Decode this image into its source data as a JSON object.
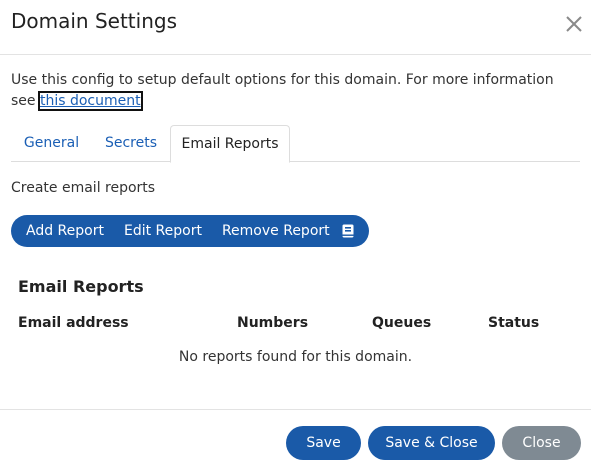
{
  "dialog": {
    "title": "Domain Settings",
    "close_icon": "close-icon"
  },
  "intro": {
    "text": "Use this config to setup default options for this domain. For more information see ",
    "link_text": "this document"
  },
  "tabs": [
    {
      "label": "General",
      "active": false
    },
    {
      "label": "Secrets",
      "active": false
    },
    {
      "label": "Email Reports",
      "active": true
    }
  ],
  "section": {
    "label": "Create email reports"
  },
  "toolbar": {
    "add_label": "Add Report",
    "edit_label": "Edit Report",
    "remove_label": "Remove Report",
    "extra_icon": "book-icon"
  },
  "table": {
    "title": "Email Reports",
    "columns": [
      "Email address",
      "Numbers",
      "Queues",
      "Status"
    ],
    "empty_message": "No reports found for this domain."
  },
  "footer": {
    "save_label": "Save",
    "save_close_label": "Save & Close",
    "close_label": "Close"
  },
  "colors": {
    "primary": "#1a5aa8",
    "secondary": "#7f8a93",
    "link": "#1b5fb5"
  }
}
